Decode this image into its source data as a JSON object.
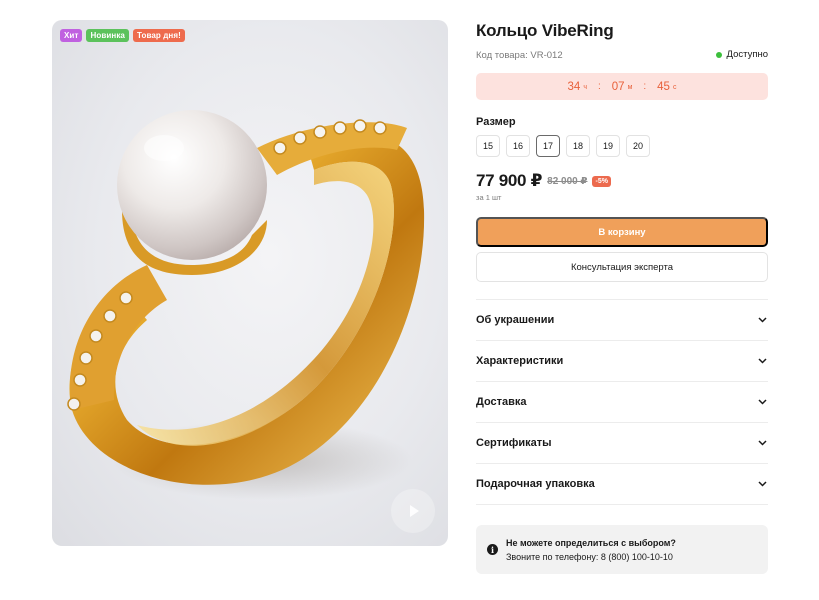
{
  "product": {
    "title": "Кольцо VibeRing",
    "sku": "Код товара: VR-012",
    "availability": "Доступно",
    "availability_color": "#3cbf3c"
  },
  "badges": [
    {
      "label": "Хит",
      "color": "#c061e0"
    },
    {
      "label": "Новинка",
      "color": "#5cc25c"
    },
    {
      "label": "Товар дня!",
      "color": "#ee6b4d"
    }
  ],
  "timer": {
    "hours": "34",
    "hours_unit": "ч",
    "minutes": "07",
    "minutes_unit": "м",
    "seconds": "45",
    "seconds_unit": "с",
    "separator": ":"
  },
  "sizes": {
    "label": "Размер",
    "options": [
      "15",
      "16",
      "17",
      "18",
      "19",
      "20"
    ],
    "selected": "17"
  },
  "pricing": {
    "price": "77 900 ₽",
    "old_price": "82 000 ₽",
    "discount": "-5%",
    "per_unit": "за 1 шт"
  },
  "actions": {
    "cart": "В корзину",
    "consult": "Консультация эксперта"
  },
  "accordion": [
    "Об украшении",
    "Характеристики",
    "Доставка",
    "Сертификаты",
    "Подарочная упаковка"
  ],
  "help": {
    "question": "Не можете определиться с выбором?",
    "phone_line": "Звоните по телефону: 8 (800) 100-10-10"
  },
  "gallery": {
    "image": "gold-ring-with-pearl",
    "video_icon": "play-icon"
  },
  "colors": {
    "accent": "#f0a05a",
    "timer_bg": "#fde2de",
    "timer_text": "#e8603a",
    "discount": "#ec6a4e"
  }
}
